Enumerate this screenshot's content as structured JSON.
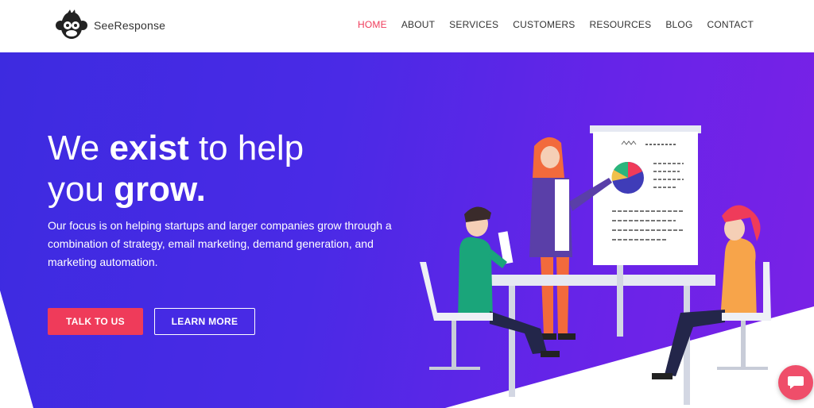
{
  "brand": {
    "name": "SeeResponse",
    "logo_icon": "monkey-logo-icon"
  },
  "nav": {
    "items": [
      {
        "label": "HOME",
        "active": true
      },
      {
        "label": "ABOUT",
        "active": false
      },
      {
        "label": "SERVICES",
        "active": false
      },
      {
        "label": "CUSTOMERS",
        "active": false
      },
      {
        "label": "RESOURCES",
        "active": false
      },
      {
        "label": "BLOG",
        "active": false
      },
      {
        "label": "CONTACT",
        "active": false
      }
    ]
  },
  "hero": {
    "headline_part1": "We ",
    "headline_bold1": "exist",
    "headline_part2": " to help",
    "headline_part3": "you ",
    "headline_bold2": "grow.",
    "subtext": "Our focus is on helping startups and larger companies grow through a combination of strategy, email marketing, demand generation, and marketing automation.",
    "primary_button": "TALK TO US",
    "secondary_button": "LEARN MORE"
  },
  "colors": {
    "accent": "#ef3b5a",
    "hero_start": "#3d2be0",
    "hero_end": "#7a22e6"
  },
  "chat": {
    "icon": "chat-bubble-icon"
  }
}
